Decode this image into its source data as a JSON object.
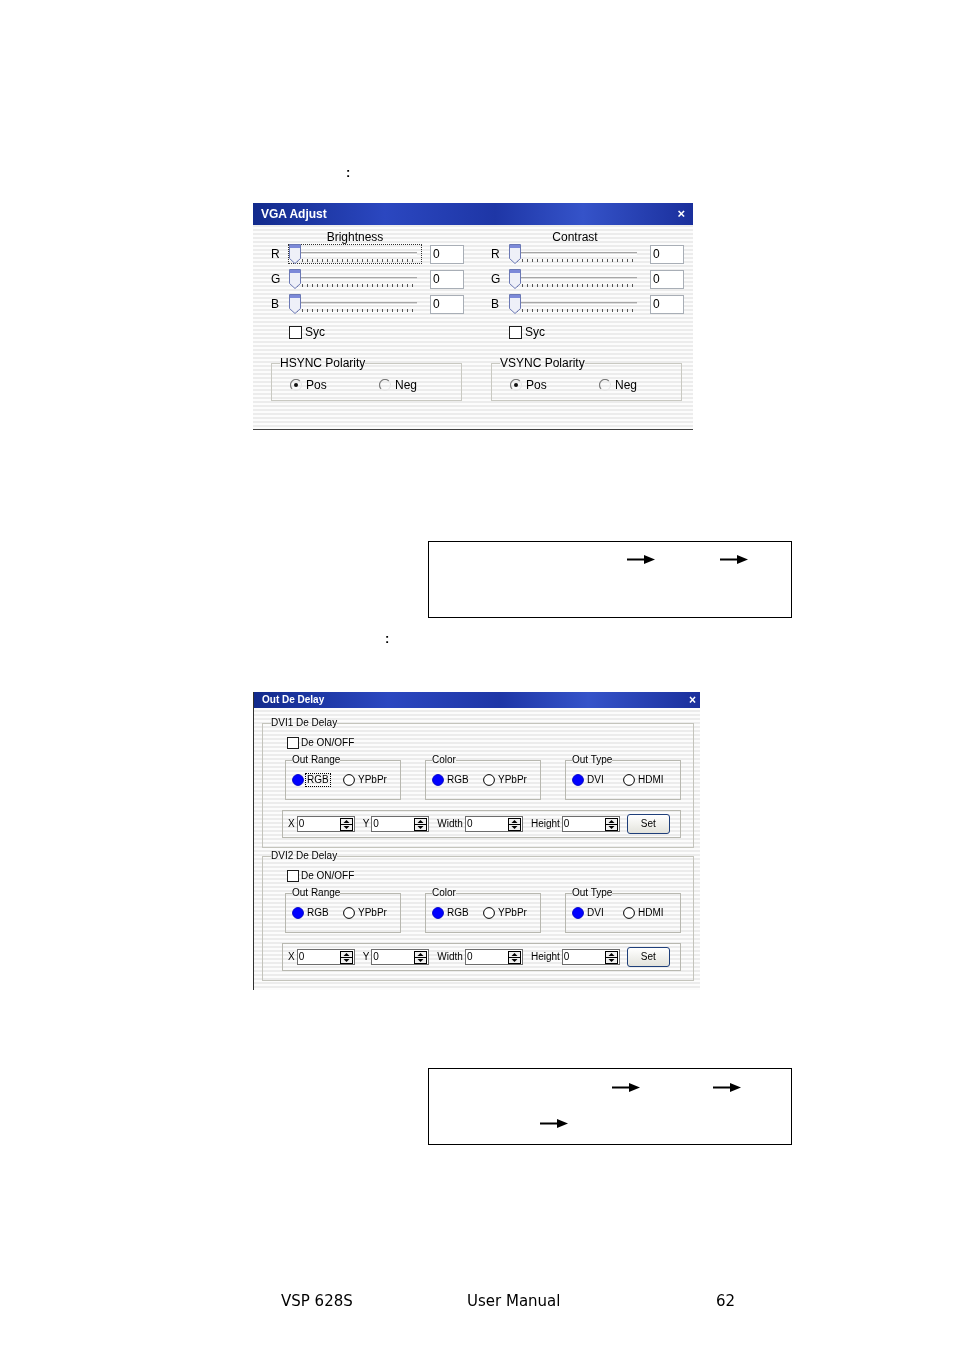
{
  "top_note": {
    "mark": ":"
  },
  "vga_adjust": {
    "title": "VGA Adjust",
    "close": "×",
    "panels": [
      {
        "heading": "Brightness",
        "sliders": [
          {
            "label": "R",
            "level": 0,
            "value": "0",
            "focused": true
          },
          {
            "label": "G",
            "level": 0,
            "value": "0",
            "focused": false
          },
          {
            "label": "B",
            "level": 0,
            "value": "0",
            "focused": false
          }
        ],
        "sync": {
          "label": "Syc",
          "checked": false
        },
        "polarity": {
          "title": "HSYNC Polarity",
          "options": [
            {
              "label": "Pos",
              "selected": true
            },
            {
              "label": "Neg",
              "selected": false
            }
          ]
        }
      },
      {
        "heading": "Contrast",
        "sliders": [
          {
            "label": "R",
            "level": 0,
            "value": "0",
            "focused": false
          },
          {
            "label": "G",
            "level": 0,
            "value": "0",
            "focused": false
          },
          {
            "label": "B",
            "level": 0,
            "value": "0",
            "focused": false
          }
        ],
        "sync": {
          "label": "Syc",
          "checked": false
        },
        "polarity": {
          "title": "VSYNC Polarity",
          "options": [
            {
              "label": "Pos",
              "selected": true
            },
            {
              "label": "Neg",
              "selected": false
            }
          ]
        }
      }
    ]
  },
  "middle_note": {
    "mark": ":"
  },
  "out_de_delay": {
    "title": "Out De Delay",
    "close": "×",
    "sections": [
      {
        "title": "DVI1 De Delay",
        "toggle": {
          "label": "De ON/OFF",
          "checked": false
        },
        "groups": [
          {
            "title": "Out Range",
            "options": [
              {
                "label": "RGB",
                "selected": true,
                "focused": true
              },
              {
                "label": "YPbPr",
                "selected": false,
                "focused": false
              }
            ]
          },
          {
            "title": "Color",
            "options": [
              {
                "label": "RGB",
                "selected": true,
                "focused": false
              },
              {
                "label": "YPbPr",
                "selected": false,
                "focused": false
              }
            ]
          },
          {
            "title": "Out Type",
            "options": [
              {
                "label": "DVI",
                "selected": true,
                "focused": false
              },
              {
                "label": "HDMI",
                "selected": false,
                "focused": false
              }
            ]
          }
        ],
        "fields": [
          {
            "label": "X",
            "value": "0"
          },
          {
            "label": "Y",
            "value": "0"
          },
          {
            "label": "Width",
            "value": "0"
          },
          {
            "label": "Height",
            "value": "0"
          }
        ],
        "button": "Set"
      },
      {
        "title": "DVI2 De Delay",
        "toggle": {
          "label": "De ON/OFF",
          "checked": false
        },
        "groups": [
          {
            "title": "Out Range",
            "options": [
              {
                "label": "RGB",
                "selected": true,
                "focused": false
              },
              {
                "label": "YPbPr",
                "selected": false,
                "focused": false
              }
            ]
          },
          {
            "title": "Color",
            "options": [
              {
                "label": "RGB",
                "selected": true,
                "focused": false
              },
              {
                "label": "YPbPr",
                "selected": false,
                "focused": false
              }
            ]
          },
          {
            "title": "Out Type",
            "options": [
              {
                "label": "DVI",
                "selected": true,
                "focused": false
              },
              {
                "label": "HDMI",
                "selected": false,
                "focused": false
              }
            ]
          }
        ],
        "fields": [
          {
            "label": "X",
            "value": "0"
          },
          {
            "label": "Y",
            "value": "0"
          },
          {
            "label": "Width",
            "value": "0"
          },
          {
            "label": "Height",
            "value": "0"
          }
        ],
        "button": "Set"
      }
    ]
  },
  "footer": {
    "product": "VSP 628S",
    "document": "User Manual",
    "page": "62"
  }
}
